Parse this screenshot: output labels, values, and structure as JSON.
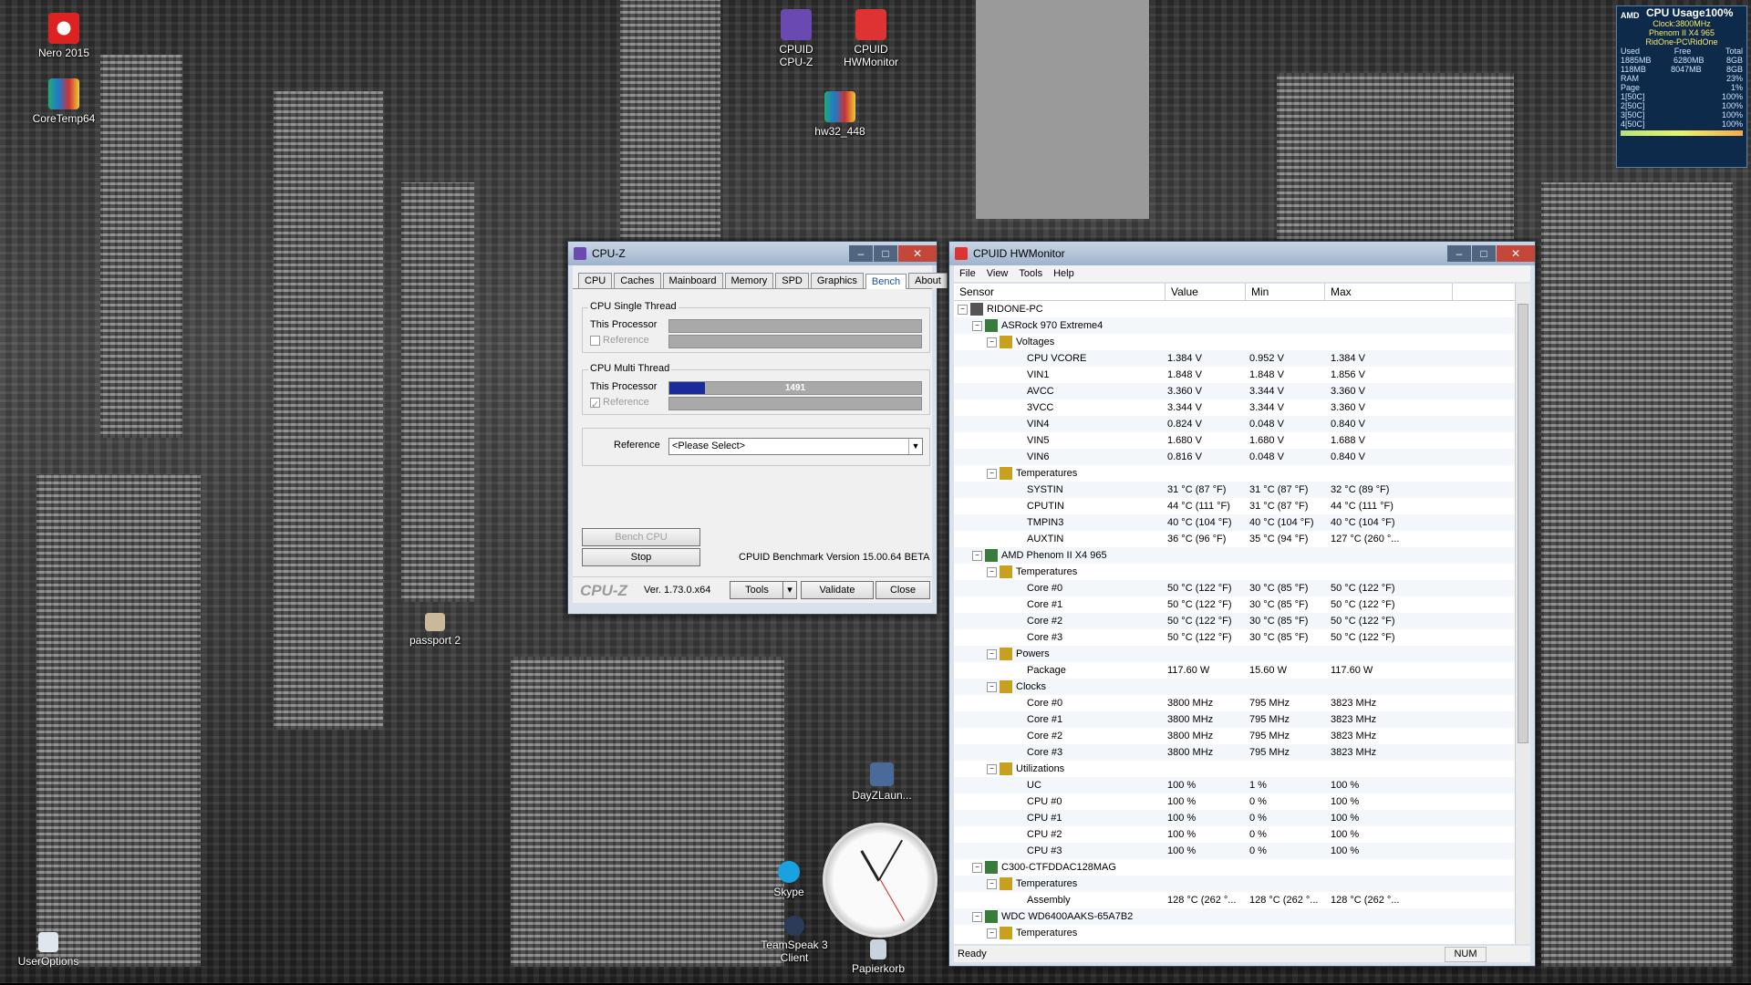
{
  "desktop": {
    "icons": [
      {
        "label": "Nero 2015"
      },
      {
        "label": "CoreTemp64"
      },
      {
        "label": "CPUID CPU-Z"
      },
      {
        "label": "CPUID HWMonitor"
      },
      {
        "label": "hw32_448"
      },
      {
        "label": "passport 2"
      },
      {
        "label": "DayZLaun..."
      },
      {
        "label": "Skype"
      },
      {
        "label": "TeamSpeak 3 Client"
      },
      {
        "label": "Papierkorb"
      },
      {
        "label": "UserOptions"
      }
    ]
  },
  "gadget": {
    "brand": "AMD",
    "title": "CPU Usage100%",
    "clock": "Clock:3800MHz",
    "cpu_name": "Phenom II X4 965",
    "machine": "RidOne-PC\\RidOne",
    "headers": [
      "Used",
      "Free",
      "Total"
    ],
    "mem_rows": [
      [
        "1885MB",
        "6280MB",
        "8GB"
      ],
      [
        "118MB",
        "8047MB",
        "8GB"
      ]
    ],
    "rows": [
      {
        "label": "RAM",
        "value": "23%"
      },
      {
        "label": "Page",
        "value": "1%"
      },
      {
        "label": "1[50C]",
        "value": "100%"
      },
      {
        "label": "2[50C]",
        "value": "100%"
      },
      {
        "label": "3[50C]",
        "value": "100%"
      },
      {
        "label": "4[50C]",
        "value": "100%"
      }
    ]
  },
  "cpuz": {
    "title": "CPU-Z",
    "tabs": [
      "CPU",
      "Caches",
      "Mainboard",
      "Memory",
      "SPD",
      "Graphics",
      "Bench",
      "About"
    ],
    "active_tab": "Bench",
    "single_thread": {
      "group": "CPU Single Thread",
      "this_processor": "This Processor",
      "reference": "Reference"
    },
    "multi_thread": {
      "group": "CPU Multi Thread",
      "this_processor": "This Processor",
      "value": "1491",
      "progress_fraction": 0.14,
      "reference": "Reference"
    },
    "reference_label": "Reference",
    "reference_select": "<Please Select>",
    "bench_button": "Bench CPU",
    "stop_button": "Stop",
    "bench_version": "CPUID Benchmark Version 15.00.64 BETA",
    "logo": "CPU-Z",
    "version": "Ver. 1.73.0.x64",
    "tools_button": "Tools",
    "validate_button": "Validate",
    "close_button": "Close"
  },
  "hwmonitor": {
    "title": "CPUID HWMonitor",
    "menu": [
      "File",
      "View",
      "Tools",
      "Help"
    ],
    "columns": [
      "Sensor",
      "Value",
      "Min",
      "Max"
    ],
    "rows": [
      {
        "level": 0,
        "name": "RIDONE-PC",
        "value": "",
        "min": "",
        "max": ""
      },
      {
        "level": 1,
        "name": "ASRock 970 Extreme4",
        "value": "",
        "min": "",
        "max": ""
      },
      {
        "level": 2,
        "name": "Voltages",
        "value": "",
        "min": "",
        "max": ""
      },
      {
        "level": 3,
        "name": "CPU VCORE",
        "value": "1.384 V",
        "min": "0.952 V",
        "max": "1.384 V"
      },
      {
        "level": 3,
        "name": "VIN1",
        "value": "1.848 V",
        "min": "1.848 V",
        "max": "1.856 V"
      },
      {
        "level": 3,
        "name": "AVCC",
        "value": "3.360 V",
        "min": "3.344 V",
        "max": "3.360 V"
      },
      {
        "level": 3,
        "name": "3VCC",
        "value": "3.344 V",
        "min": "3.344 V",
        "max": "3.360 V"
      },
      {
        "level": 3,
        "name": "VIN4",
        "value": "0.824 V",
        "min": "0.048 V",
        "max": "0.840 V"
      },
      {
        "level": 3,
        "name": "VIN5",
        "value": "1.680 V",
        "min": "1.680 V",
        "max": "1.688 V"
      },
      {
        "level": 3,
        "name": "VIN6",
        "value": "0.816 V",
        "min": "0.048 V",
        "max": "0.840 V"
      },
      {
        "level": 2,
        "name": "Temperatures",
        "value": "",
        "min": "",
        "max": ""
      },
      {
        "level": 3,
        "name": "SYSTIN",
        "value": "31 °C  (87 °F)",
        "min": "31 °C  (87 °F)",
        "max": "32 °C  (89 °F)"
      },
      {
        "level": 3,
        "name": "CPUTIN",
        "value": "44 °C  (111 °F)",
        "min": "31 °C  (87 °F)",
        "max": "44 °C  (111 °F)"
      },
      {
        "level": 3,
        "name": "TMPIN3",
        "value": "40 °C  (104 °F)",
        "min": "40 °C  (104 °F)",
        "max": "40 °C  (104 °F)"
      },
      {
        "level": 3,
        "name": "AUXTIN",
        "value": "36 °C  (96 °F)",
        "min": "35 °C  (94 °F)",
        "max": "127 °C  (260 °..."
      },
      {
        "level": 1,
        "name": "AMD Phenom II X4 965",
        "value": "",
        "min": "",
        "max": ""
      },
      {
        "level": 2,
        "name": "Temperatures",
        "value": "",
        "min": "",
        "max": ""
      },
      {
        "level": 3,
        "name": "Core #0",
        "value": "50 °C  (122 °F)",
        "min": "30 °C  (85 °F)",
        "max": "50 °C  (122 °F)"
      },
      {
        "level": 3,
        "name": "Core #1",
        "value": "50 °C  (122 °F)",
        "min": "30 °C  (85 °F)",
        "max": "50 °C  (122 °F)"
      },
      {
        "level": 3,
        "name": "Core #2",
        "value": "50 °C  (122 °F)",
        "min": "30 °C  (85 °F)",
        "max": "50 °C  (122 °F)"
      },
      {
        "level": 3,
        "name": "Core #3",
        "value": "50 °C  (122 °F)",
        "min": "30 °C  (85 °F)",
        "max": "50 °C  (122 °F)"
      },
      {
        "level": 2,
        "name": "Powers",
        "value": "",
        "min": "",
        "max": ""
      },
      {
        "level": 3,
        "name": "Package",
        "value": "117.60 W",
        "min": "15.60 W",
        "max": "117.60 W"
      },
      {
        "level": 2,
        "name": "Clocks",
        "value": "",
        "min": "",
        "max": ""
      },
      {
        "level": 3,
        "name": "Core #0",
        "value": "3800 MHz",
        "min": "795 MHz",
        "max": "3823 MHz"
      },
      {
        "level": 3,
        "name": "Core #1",
        "value": "3800 MHz",
        "min": "795 MHz",
        "max": "3823 MHz"
      },
      {
        "level": 3,
        "name": "Core #2",
        "value": "3800 MHz",
        "min": "795 MHz",
        "max": "3823 MHz"
      },
      {
        "level": 3,
        "name": "Core #3",
        "value": "3800 MHz",
        "min": "795 MHz",
        "max": "3823 MHz"
      },
      {
        "level": 2,
        "name": "Utilizations",
        "value": "",
        "min": "",
        "max": ""
      },
      {
        "level": 3,
        "name": "UC",
        "value": "100 %",
        "min": "1 %",
        "max": "100 %"
      },
      {
        "level": 3,
        "name": "CPU #0",
        "value": "100 %",
        "min": "0 %",
        "max": "100 %"
      },
      {
        "level": 3,
        "name": "CPU #1",
        "value": "100 %",
        "min": "0 %",
        "max": "100 %"
      },
      {
        "level": 3,
        "name": "CPU #2",
        "value": "100 %",
        "min": "0 %",
        "max": "100 %"
      },
      {
        "level": 3,
        "name": "CPU #3",
        "value": "100 %",
        "min": "0 %",
        "max": "100 %"
      },
      {
        "level": 1,
        "name": "C300-CTFDDAC128MAG",
        "value": "",
        "min": "",
        "max": ""
      },
      {
        "level": 2,
        "name": "Temperatures",
        "value": "",
        "min": "",
        "max": ""
      },
      {
        "level": 3,
        "name": "Assembly",
        "value": "128 °C  (262 °...",
        "min": "128 °C  (262 °...",
        "max": "128 °C  (262 °..."
      },
      {
        "level": 1,
        "name": "WDC WD6400AAKS-65A7B2",
        "value": "",
        "min": "",
        "max": ""
      },
      {
        "level": 2,
        "name": "Temperatures",
        "value": "",
        "min": "",
        "max": ""
      }
    ],
    "status": "Ready",
    "num_indicator": "NUM"
  },
  "colors": {
    "cpuz_bar": "#1b2a9a",
    "close_red": "#c4473a",
    "gadget_bg": "#0d2a4a"
  }
}
